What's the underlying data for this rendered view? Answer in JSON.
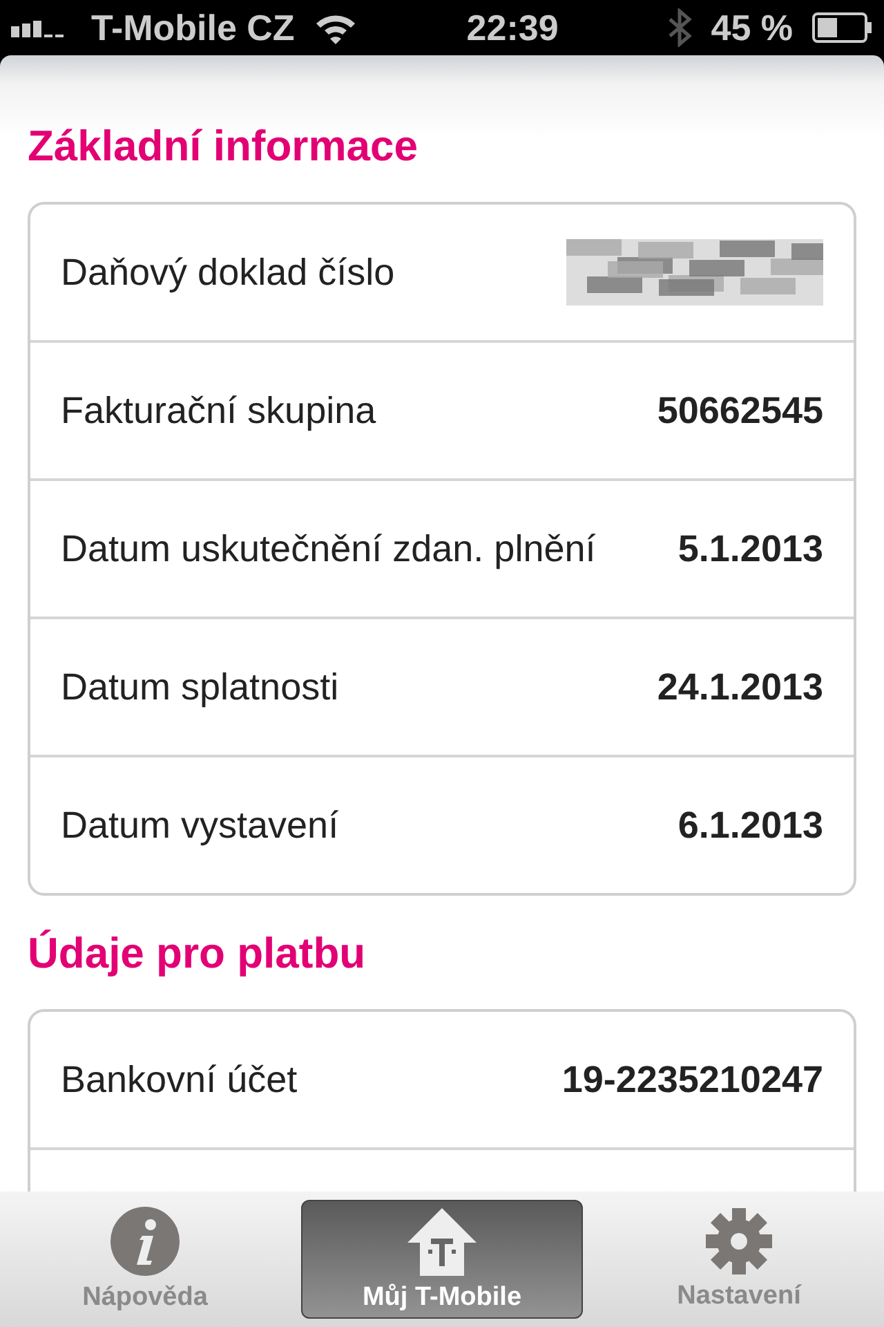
{
  "status_bar": {
    "carrier": "T-Mobile CZ",
    "time": "22:39",
    "battery": "45 %"
  },
  "sections": [
    {
      "title": "Základní informace",
      "rows": [
        {
          "label": "Daňový doklad číslo",
          "kind": "picture"
        },
        {
          "label": "Fakturační skupina",
          "value": "50662545",
          "kind": "text"
        },
        {
          "label": "Datum uskutečnění zdan. plnění",
          "value": "5.1.2013",
          "kind": "text"
        },
        {
          "label": "Datum splatnosti",
          "value": "24.1.2013",
          "kind": "text"
        },
        {
          "label": "Datum vystavení",
          "value": "6.1.2013",
          "kind": "text"
        }
      ]
    },
    {
      "title": "Údaje pro platbu",
      "rows": [
        {
          "label": "Bankovní účet",
          "value": "19-2235210247",
          "kind": "text"
        },
        {
          "kind": "empty"
        }
      ]
    }
  ],
  "tab_bar": [
    {
      "label": "Nápověda",
      "kind": "info",
      "selected": false
    },
    {
      "label": "Můj T-Mobile",
      "kind": "home",
      "selected": true
    },
    {
      "label": "Nastavení",
      "kind": "gear",
      "selected": false
    }
  ]
}
